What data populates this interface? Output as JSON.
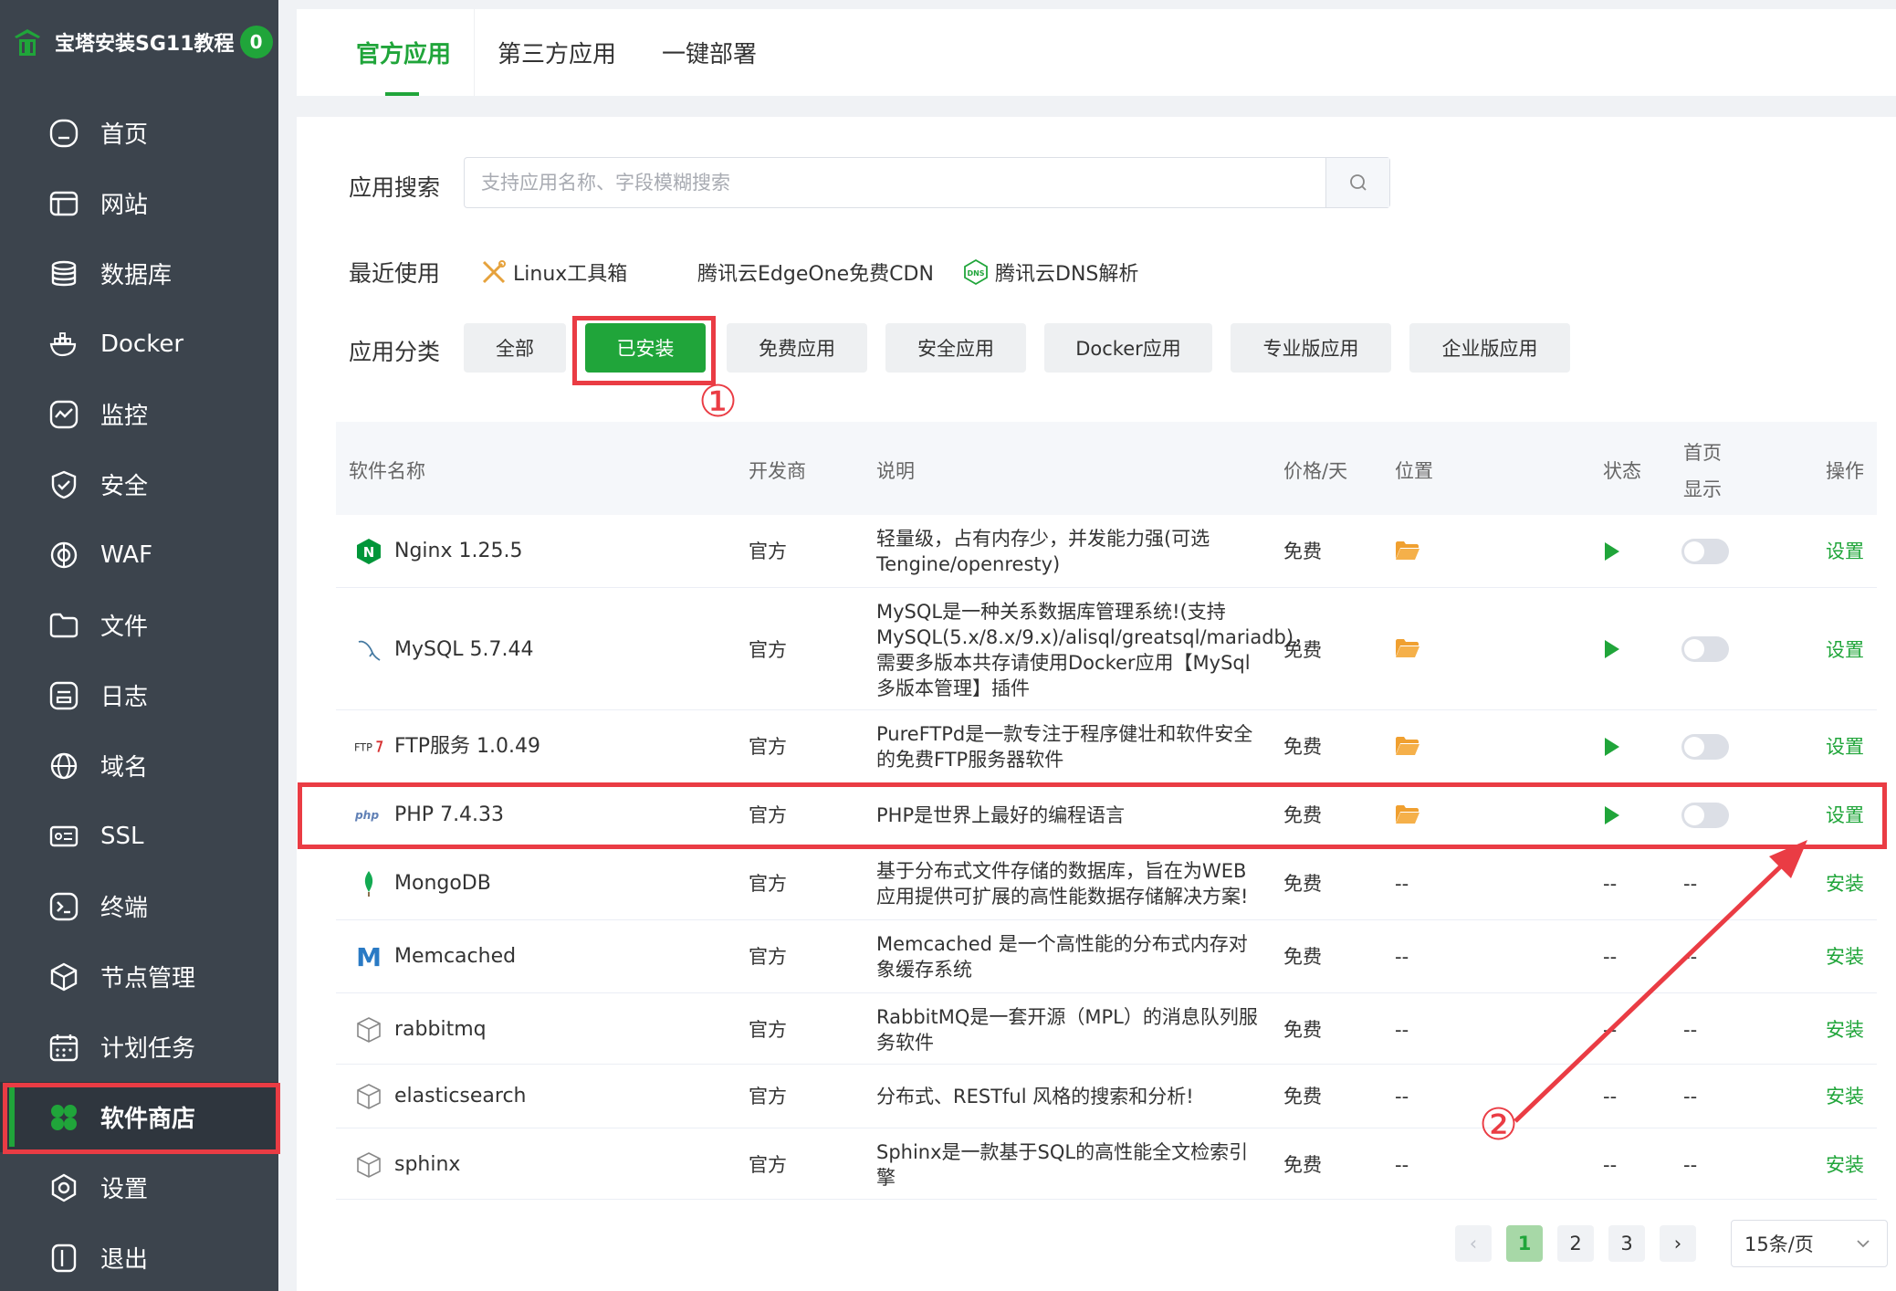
{
  "sidebar": {
    "brand": "宝塔安装SG11教程",
    "badge": "0",
    "items": [
      {
        "label": "首页",
        "icon": "home-icon"
      },
      {
        "label": "网站",
        "icon": "website-icon"
      },
      {
        "label": "数据库",
        "icon": "database-icon"
      },
      {
        "label": "Docker",
        "icon": "docker-icon"
      },
      {
        "label": "监控",
        "icon": "monitor-icon"
      },
      {
        "label": "安全",
        "icon": "shield-icon"
      },
      {
        "label": "WAF",
        "icon": "waf-icon"
      },
      {
        "label": "文件",
        "icon": "folder-icon"
      },
      {
        "label": "日志",
        "icon": "log-icon"
      },
      {
        "label": "域名",
        "icon": "globe-icon"
      },
      {
        "label": "SSL",
        "icon": "ssl-icon"
      },
      {
        "label": "终端",
        "icon": "terminal-icon"
      },
      {
        "label": "节点管理",
        "icon": "node-icon"
      },
      {
        "label": "计划任务",
        "icon": "calendar-icon"
      },
      {
        "label": "软件商店",
        "icon": "store-icon",
        "active": true
      },
      {
        "label": "设置",
        "icon": "gear-icon"
      },
      {
        "label": "退出",
        "icon": "logout-icon"
      }
    ]
  },
  "tabs": [
    "官方应用",
    "第三方应用",
    "一键部署"
  ],
  "search": {
    "label": "应用搜索",
    "placeholder": "支持应用名称、字段模糊搜索"
  },
  "recent": {
    "label": "最近使用",
    "items": [
      "Linux工具箱",
      "腾讯云EdgeOne免费CDN",
      "腾讯云DNS解析"
    ]
  },
  "category": {
    "label": "应用分类",
    "items": [
      "全部",
      "已安装",
      "免费应用",
      "安全应用",
      "Docker应用",
      "专业版应用",
      "企业版应用"
    ]
  },
  "annotations": {
    "one": "①",
    "two": "②"
  },
  "table": {
    "headers": {
      "name": "软件名称",
      "vendor": "开发商",
      "desc": "说明",
      "price": "价格/天",
      "location": "位置",
      "status": "状态",
      "home1": "首页",
      "home2": "显示",
      "ops": "操作"
    },
    "rows": [
      {
        "name": "Nginx 1.25.5",
        "vendor": "官方",
        "desc": "轻量级，占有内存少，并发能力强(可选Tengine/openresty)",
        "price": "免费",
        "op": "设置"
      },
      {
        "name": "MySQL 5.7.44",
        "vendor": "官方",
        "desc": "MySQL是一种关系数据库管理系统!(支持MySQL(5.x/8.x/9.x)/alisql/greatsql/mariadb)，需要多版本共存请使用Docker应用【MySql多版本管理】插件",
        "price": "免费",
        "op": "设置"
      },
      {
        "name": "FTP服务 1.0.49",
        "vendor": "官方",
        "desc": "PureFTPd是一款专注于程序健壮和软件安全的免费FTP服务器软件",
        "price": "免费",
        "op": "设置"
      },
      {
        "name": "PHP 7.4.33",
        "vendor": "官方",
        "desc": "PHP是世界上最好的编程语言",
        "price": "免费",
        "op": "设置"
      },
      {
        "name": "MongoDB",
        "vendor": "官方",
        "desc": "基于分布式文件存储的数据库，旨在为WEB应用提供可扩展的高性能数据存储解决方案!",
        "price": "免费",
        "location": "--",
        "status": "--",
        "home": "--",
        "op": "安装"
      },
      {
        "name": "Memcached",
        "vendor": "官方",
        "desc": "Memcached 是一个高性能的分布式内存对象缓存系统",
        "price": "免费",
        "location": "--",
        "status": "--",
        "home": "--",
        "op": "安装"
      },
      {
        "name": "rabbitmq",
        "vendor": "官方",
        "desc": "RabbitMQ是一套开源（MPL）的消息队列服务软件",
        "price": "免费",
        "location": "--",
        "status": "--",
        "home": "--",
        "op": "安装"
      },
      {
        "name": "elasticsearch",
        "vendor": "官方",
        "desc": "分布式、RESTful 风格的搜索和分析!",
        "price": "免费",
        "location": "--",
        "status": "--",
        "home": "--",
        "op": "安装"
      },
      {
        "name": "sphinx",
        "vendor": "官方",
        "desc": "Sphinx是一款基于SQL的高性能全文检索引擎",
        "price": "免费",
        "location": "--",
        "status": "--",
        "home": "--",
        "op": "安装"
      }
    ]
  },
  "pagination": {
    "prev": "‹",
    "pages": [
      "1",
      "2",
      "3"
    ],
    "next": "›",
    "page_size": "15条/页",
    "current": 1
  },
  "colors": {
    "accent": "#20a53a",
    "sidebar": "#3c444d",
    "annotation": "#ea3c44"
  }
}
